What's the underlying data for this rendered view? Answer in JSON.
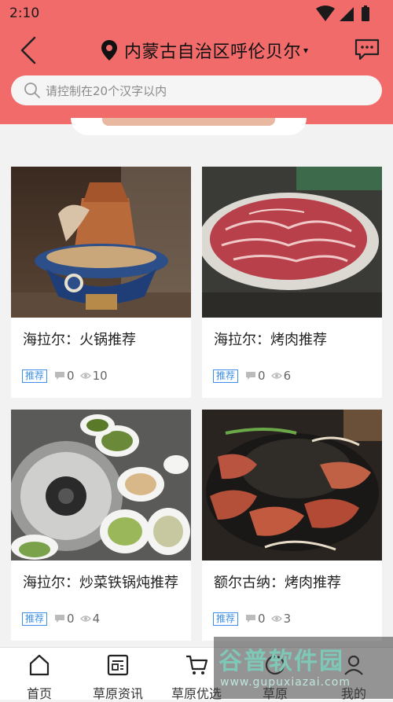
{
  "status": {
    "time": "2:10"
  },
  "header": {
    "location": "内蒙古自治区呼伦贝尔",
    "caret": "▾",
    "search_placeholder": "请控制在20个汉字以内"
  },
  "cards": [
    {
      "title": "海拉尔：火锅推荐",
      "tag": "推荐",
      "comments": "0",
      "views": "10"
    },
    {
      "title": "海拉尔：烤肉推荐",
      "tag": "推荐",
      "comments": "0",
      "views": "6"
    },
    {
      "title": "海拉尔：炒菜铁锅炖推荐",
      "tag": "推荐",
      "comments": "0",
      "views": "4"
    },
    {
      "title": "额尔古纳：烤肉推荐",
      "tag": "推荐",
      "comments": "0",
      "views": "3"
    }
  ],
  "tabs": [
    {
      "label": "首页",
      "icon": "home-icon"
    },
    {
      "label": "草原资讯",
      "icon": "news-icon"
    },
    {
      "label": "草原优选",
      "icon": "cart-icon"
    },
    {
      "label": "草原",
      "icon": "community-icon"
    },
    {
      "label": "我的",
      "icon": "user-icon"
    }
  ],
  "watermark": {
    "brand": "谷普软件园",
    "url": "www.gupuxiazai.com"
  },
  "colors": {
    "header": "#f26b6b",
    "tag": "#3d8ee6",
    "background": "#f2f2f2"
  }
}
